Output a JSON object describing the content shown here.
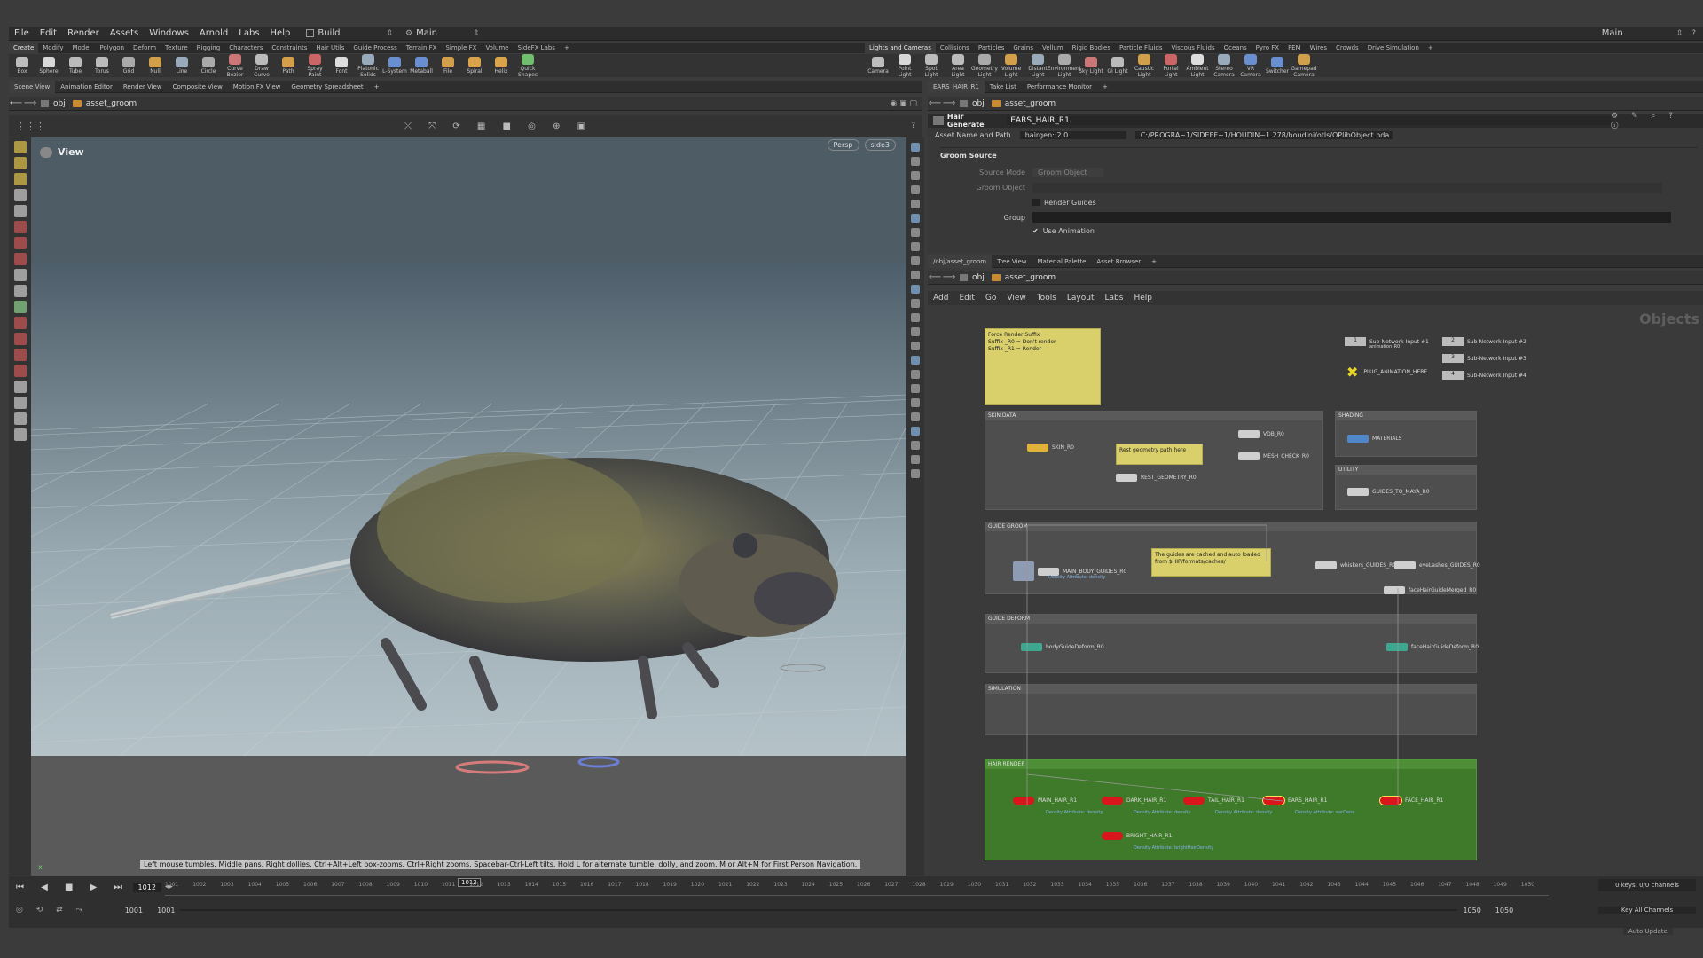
{
  "menu": [
    "File",
    "Edit",
    "Render",
    "Assets",
    "Windows",
    "Arnold",
    "Labs",
    "Help"
  ],
  "desktop": {
    "left": "Build",
    "right": "Main"
  },
  "shelf_tabs_left": [
    "Create",
    "Modify",
    "Model",
    "Polygon",
    "Deform",
    "Texture",
    "Rigging",
    "Characters",
    "Constraints",
    "Hair Utils",
    "Guide Process",
    "Terrain FX",
    "Simple FX",
    "Volume",
    "SideFX Labs"
  ],
  "shelf_tools_left": [
    "Box",
    "Sphere",
    "Tube",
    "Torus",
    "Grid",
    "Null",
    "Line",
    "Circle",
    "Curve Bezier",
    "Draw Curve",
    "Path",
    "Spray Paint",
    "Font",
    "Platonic Solids",
    "L-System",
    "Metaball",
    "File",
    "Spiral",
    "Helix",
    "Quick Shapes"
  ],
  "shelf_tabs_right": [
    "Lights and Cameras",
    "Collisions",
    "Particles",
    "Grains",
    "Vellum",
    "Rigid Bodies",
    "Particle Fluids",
    "Viscous Fluids",
    "Oceans",
    "Pyro FX",
    "FEM",
    "Wires",
    "Crowds",
    "Drive Simulation"
  ],
  "shelf_tools_right": [
    "Camera",
    "Point Light",
    "Spot Light",
    "Area Light",
    "Geometry Light",
    "Volume Light",
    "Distant Light",
    "Environment Light",
    "Sky Light",
    "GI Light",
    "Caustic Light",
    "Portal Light",
    "Ambient Light",
    "Stereo Camera",
    "VR Camera",
    "Switcher",
    "Gamepad Camera"
  ],
  "left_pane_tabs": [
    "Scene View",
    "Animation Editor",
    "Render View",
    "Composite View",
    "Motion FX View",
    "Geometry Spreadsheet"
  ],
  "right_top_tabs": [
    "EARS_HAIR_R1",
    "Take List",
    "Performance Monitor"
  ],
  "path": {
    "root": "obj",
    "network": "asset_groom"
  },
  "viewport": {
    "title": "View",
    "camera": "Persp",
    "display": "side3",
    "hint": "Left mouse tumbles. Middle pans. Right dollies. Ctrl+Alt+Left box-zooms. Ctrl+Right zooms. Spacebar-Ctrl-Left tilts. Hold L for alternate tumble, dolly, and zoom. M or Alt+M for First Person Navigation."
  },
  "params": {
    "node_type": "Hair Generate",
    "node_name": "EARS_HAIR_R1",
    "asset_label": "Asset Name and Path",
    "asset_name": "hairgen::2.0",
    "asset_path": "C:/PROGRA~1/SIDEEF~1/HOUDIN~1.278/houdini/otls/OPlibObject.hda",
    "section": "Groom Source",
    "source_mode_label": "Source Mode",
    "source_mode": "Groom Object",
    "groom_object_label": "Groom Object",
    "render_guides": "Render Guides",
    "group_label": "Group",
    "use_animation": "Use Animation"
  },
  "net_tabs": [
    "/obj/asset_groom",
    "Tree View",
    "Material Palette",
    "Asset Browser"
  ],
  "net_menu": [
    "Add",
    "Edit",
    "Go",
    "View",
    "Tools",
    "Layout",
    "Labs",
    "Help"
  ],
  "net_context": "Objects",
  "network": {
    "sticky_render": "Force Render Suffix\nSuffix _R0 = Don't render\nSuffix _R1 = Render",
    "sticky_geo": "Rest geometry path here",
    "sticky_guides": "The guides are cached and auto loaded from $HIP/formats/caches/",
    "inputs": [
      "Sub-Network Input #1",
      "Sub-Network Input #2",
      "Sub-Network Input #3",
      "Sub-Network Input #4"
    ],
    "input1_sub": "animation_R0",
    "input_nums": [
      "1",
      "2",
      "3",
      "4"
    ],
    "plug": "PLUG_ANIMATION_HERE",
    "boxes": {
      "skin": "SKIN DATA",
      "shading": "SHADING",
      "utility": "UTILITY",
      "guide_groom": "GUIDE GROOM",
      "guide_deform": "GUIDE DEFORM",
      "simulation": "SIMULATION",
      "hair_render": "HAIR RENDER"
    },
    "nodes": {
      "skin": "SKIN_R0",
      "vdb": "VDB_R0",
      "mesh_check": "MESH_CHECK_R0",
      "rest_geo": "REST_GEOMETRY_R0",
      "materials": "MATERIALS",
      "guides_to_maya": "GUIDES_TO_MAYA_R0",
      "main_body": "MAIN_BODY_GUIDES_R0",
      "whiskers": "whiskers_GUIDES_R0",
      "eyelashes": "eyeLashes_GUIDES_R0",
      "face_merged": "faceHairGuideMerged_R0",
      "body_deform": "bodyGuideDeform_R0",
      "face_deform": "faceHairGuideDeform_R0",
      "main_hair": "MAIN_HAIR_R1",
      "dark_hair": "DARK_HAIR_R1",
      "tail_hair": "TAIL_HAIR_R1",
      "ears_hair": "EARS_HAIR_R1",
      "face_hair": "FACE_HAIR_R1",
      "bright_hair": "BRIGHT_HAIR_R1"
    },
    "sub_density": "Density Attribute: density",
    "sub_bright": "Density Attribute: brightHairDensity",
    "sub_ears": "Density Attribute: earDens"
  },
  "timeline": {
    "frame": "1012",
    "frames": [
      "1001",
      "1002",
      "1003",
      "1004",
      "1005",
      "1006",
      "1007",
      "1008",
      "1009",
      "1010",
      "1011",
      "1012",
      "1013",
      "1014",
      "1015",
      "1016",
      "1017",
      "1018",
      "1019",
      "1020",
      "1021",
      "1022",
      "1023",
      "1024",
      "1025",
      "1026",
      "1027",
      "1028",
      "1029",
      "1030",
      "1031",
      "1032",
      "1033",
      "1034",
      "1035",
      "1036",
      "1037",
      "1038",
      "1039",
      "1040",
      "1041",
      "1042",
      "1043",
      "1044",
      "1045",
      "1046",
      "1047",
      "1048",
      "1049",
      "1050"
    ],
    "start": "1001",
    "start2": "1001",
    "end": "1050",
    "end2": "1050",
    "keys": "0 keys, 0/0 channels",
    "key_all": "Key All Channels",
    "auto_update": "Auto Update"
  }
}
